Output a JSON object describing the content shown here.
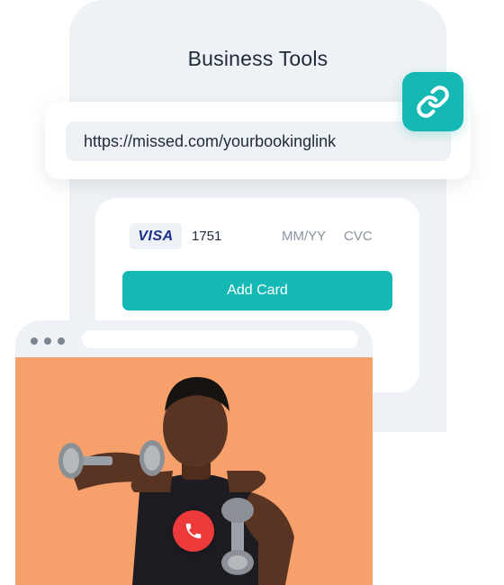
{
  "business_tools": {
    "title": "Business Tools",
    "booking_link": "https://missed.com/yourbookinglink",
    "link_icon": "link-icon",
    "accent_color": "#16b8b4"
  },
  "payment": {
    "card_brand": "VISA",
    "card_last4": "1751",
    "expiry_placeholder": "MM/YY",
    "cvc_placeholder": "CVC",
    "add_card_label": "Add Card"
  },
  "video_call": {
    "window_dots": 3,
    "hangup_icon": "phone-icon",
    "hangup_color": "#ee3a3a",
    "background_color": "#f6a06c"
  }
}
